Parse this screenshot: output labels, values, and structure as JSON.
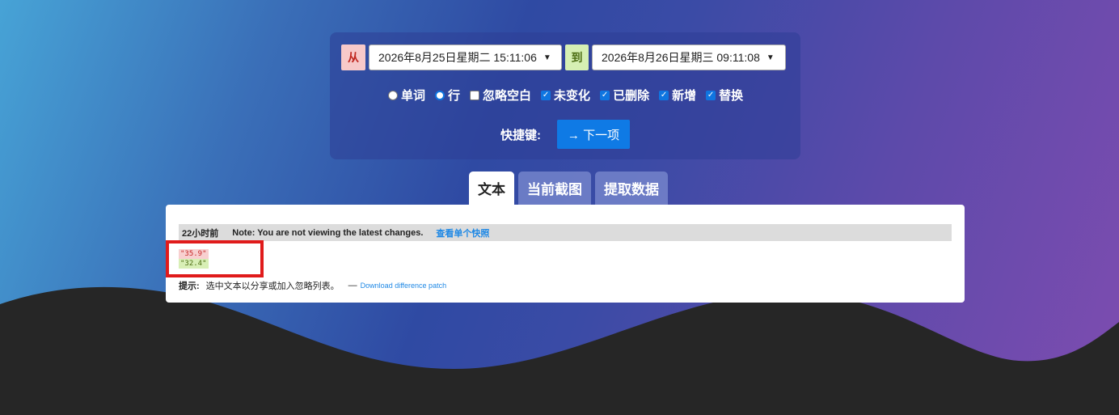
{
  "controls": {
    "from_label": "从",
    "from_value": "2026年8月25日星期二 15:11:06",
    "to_label": "到",
    "to_value": "2026年8月26日星期三 09:11:08",
    "options": [
      {
        "type": "radio",
        "label": "单词",
        "checked": false
      },
      {
        "type": "radio",
        "label": "行",
        "checked": true
      },
      {
        "type": "checkbox",
        "label": "忽略空白",
        "checked": false
      },
      {
        "type": "checkbox",
        "label": "未变化",
        "checked": true
      },
      {
        "type": "checkbox",
        "label": "已删除",
        "checked": true
      },
      {
        "type": "checkbox",
        "label": "新增",
        "checked": true
      },
      {
        "type": "checkbox",
        "label": "替换",
        "checked": true
      }
    ],
    "shortcut_label": "快捷键:",
    "next_button": "→ 下一项"
  },
  "tabs": [
    {
      "label": "文本",
      "active": true
    },
    {
      "label": "当前截图",
      "active": false
    },
    {
      "label": "提取数据",
      "active": false
    }
  ],
  "content": {
    "time_ago": "22小时前",
    "note": "Note: You are not viewing the latest changes.",
    "snapshot_link": "查看单个快照",
    "removed_line": "\"35.9\"",
    "added_line": "\"32.4\"",
    "hint_label": "提示:",
    "hint_text": "选中文本以分享或加入忽略列表。",
    "dash": "—",
    "patch_link": "Download difference patch"
  },
  "colors": {
    "accent_blue": "#0f7ae5",
    "removed_bg": "#f8d0d0",
    "added_bg": "#d8efb6",
    "highlight_box": "#e01b1b",
    "footer_wave": "#262626"
  }
}
